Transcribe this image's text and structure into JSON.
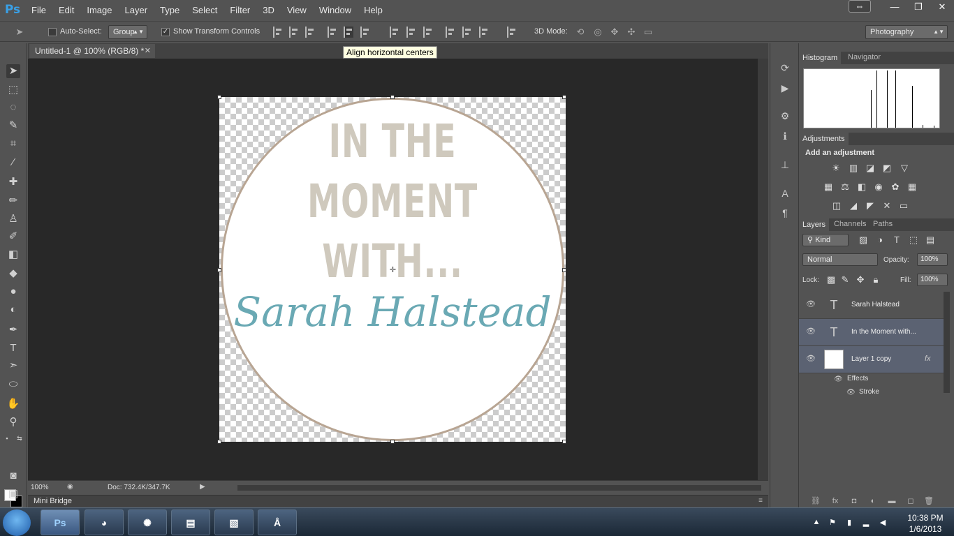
{
  "app": {
    "logo": "Ps"
  },
  "menu": [
    "File",
    "Edit",
    "Image",
    "Layer",
    "Type",
    "Select",
    "Filter",
    "3D",
    "View",
    "Window",
    "Help"
  ],
  "options": {
    "auto_select_label": "Auto-Select:",
    "auto_select_checked": false,
    "auto_select_target": "Group",
    "show_transform_label": "Show Transform Controls",
    "show_transform_checked": true,
    "mode_3d_label": "3D Mode:",
    "workspace": "Photography"
  },
  "tooltip": "Align horizontal centers",
  "document": {
    "tab_title": "Untitled-1 @ 100% (RGB/8) *"
  },
  "canvas_text": {
    "line1": "IN THE",
    "line2": "MOMENT",
    "line3": "WITH...",
    "script": "Sarah Halstead",
    "text_color": "#cfc9bd",
    "script_color": "#6aa9b4",
    "ring_color": "#b8a593"
  },
  "status": {
    "zoom": "100%",
    "doc_size": "Doc: 732.4K/347.7K"
  },
  "mini_bridge": "Mini Bridge",
  "panels": {
    "histogram_tabs": [
      "Histogram",
      "Navigator"
    ],
    "adjustments_tab": "Adjustments",
    "adjustments_title": "Add an adjustment",
    "layers_tabs": [
      "Layers",
      "Channels",
      "Paths"
    ],
    "filter_kind": "Kind",
    "blend_mode": "Normal",
    "opacity_label": "Opacity:",
    "opacity_value": "100%",
    "lock_label": "Lock:",
    "fill_label": "Fill:",
    "fill_value": "100%",
    "layers": [
      {
        "name": "Sarah Halstead",
        "type": "text",
        "selected": false
      },
      {
        "name": "In the Moment with...",
        "type": "text",
        "selected": true
      },
      {
        "name": "Layer 1 copy",
        "type": "raster",
        "selected": true
      }
    ],
    "effects_label": "Effects",
    "stroke_label": "Stroke"
  },
  "taskbar": {
    "time": "10:38 PM",
    "date": "1/6/2013",
    "ps_label": "Ps"
  }
}
